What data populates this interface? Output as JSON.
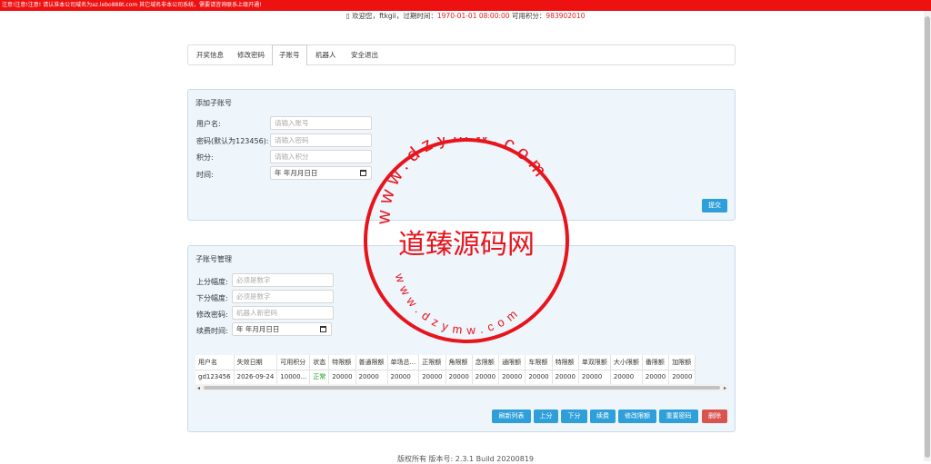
{
  "topbar": {
    "notice": "注意!注意!注意! 请认准本公司域名为az.lebo888t.com 其它域名非本公司系统，需要请咨询联系上级开通!"
  },
  "welcome": {
    "icon": "user-icon",
    "prefix": "欢迎您，",
    "username": "ftkgii",
    "expire_label": "，过期时间：",
    "expire_value": "1970-01-01 08:00:00",
    "points_label": "可用积分：",
    "points_value": "983902010"
  },
  "nav": {
    "tabs": [
      "开奖信息",
      "修改密码",
      "子账号",
      "机器人",
      "安全退出"
    ],
    "active": "子账号"
  },
  "add_panel": {
    "title": "添加子账号",
    "fields": [
      {
        "label": "用户名:",
        "placeholder": "请输入账号"
      },
      {
        "label": "密码(默认为123456):",
        "placeholder": "请输入密码"
      },
      {
        "label": "积分:",
        "placeholder": "请输入积分"
      },
      {
        "label": "时间:",
        "value": "年 年月月日日"
      }
    ],
    "submit": "提交"
  },
  "manage_panel": {
    "title": "子账号管理",
    "fields": [
      {
        "label": "上分幅度:",
        "placeholder": "必须是数字"
      },
      {
        "label": "下分幅度:",
        "placeholder": "必须是数字"
      },
      {
        "label": "修改密码:",
        "placeholder": "机器人新密码"
      },
      {
        "label": "续费时间:",
        "value": "年 年月月日日"
      }
    ],
    "table": {
      "headers": [
        "用户名",
        "失效日期",
        "可用积分",
        "状态",
        "特限额",
        "普通限额",
        "单场总...",
        "正限额",
        "角限额",
        "念限额",
        "通限额",
        "车限额",
        "特限额",
        "单双限额",
        "大小限额",
        "番限额",
        "加限额"
      ],
      "rows": [
        [
          "gd123456",
          "2026-09-24",
          "10000...",
          "正常",
          "20000",
          "20000",
          "20000",
          "20000",
          "20000",
          "20000",
          "20000",
          "20000",
          "20000",
          "20000",
          "20000",
          "20000",
          "20000"
        ]
      ]
    },
    "buttons": [
      "刷新列表",
      "上分",
      "下分",
      "续费",
      "修改限额",
      "重置密码",
      "删除"
    ]
  },
  "watermark": {
    "top_arc": "www.dzymw.com",
    "center": "道臻源码网",
    "bottom_arc": "www.dzymw.com",
    "color": "#e8141c"
  },
  "footer": {
    "text": "版权所有 版本号: 2.3.1 Build 20200819"
  }
}
